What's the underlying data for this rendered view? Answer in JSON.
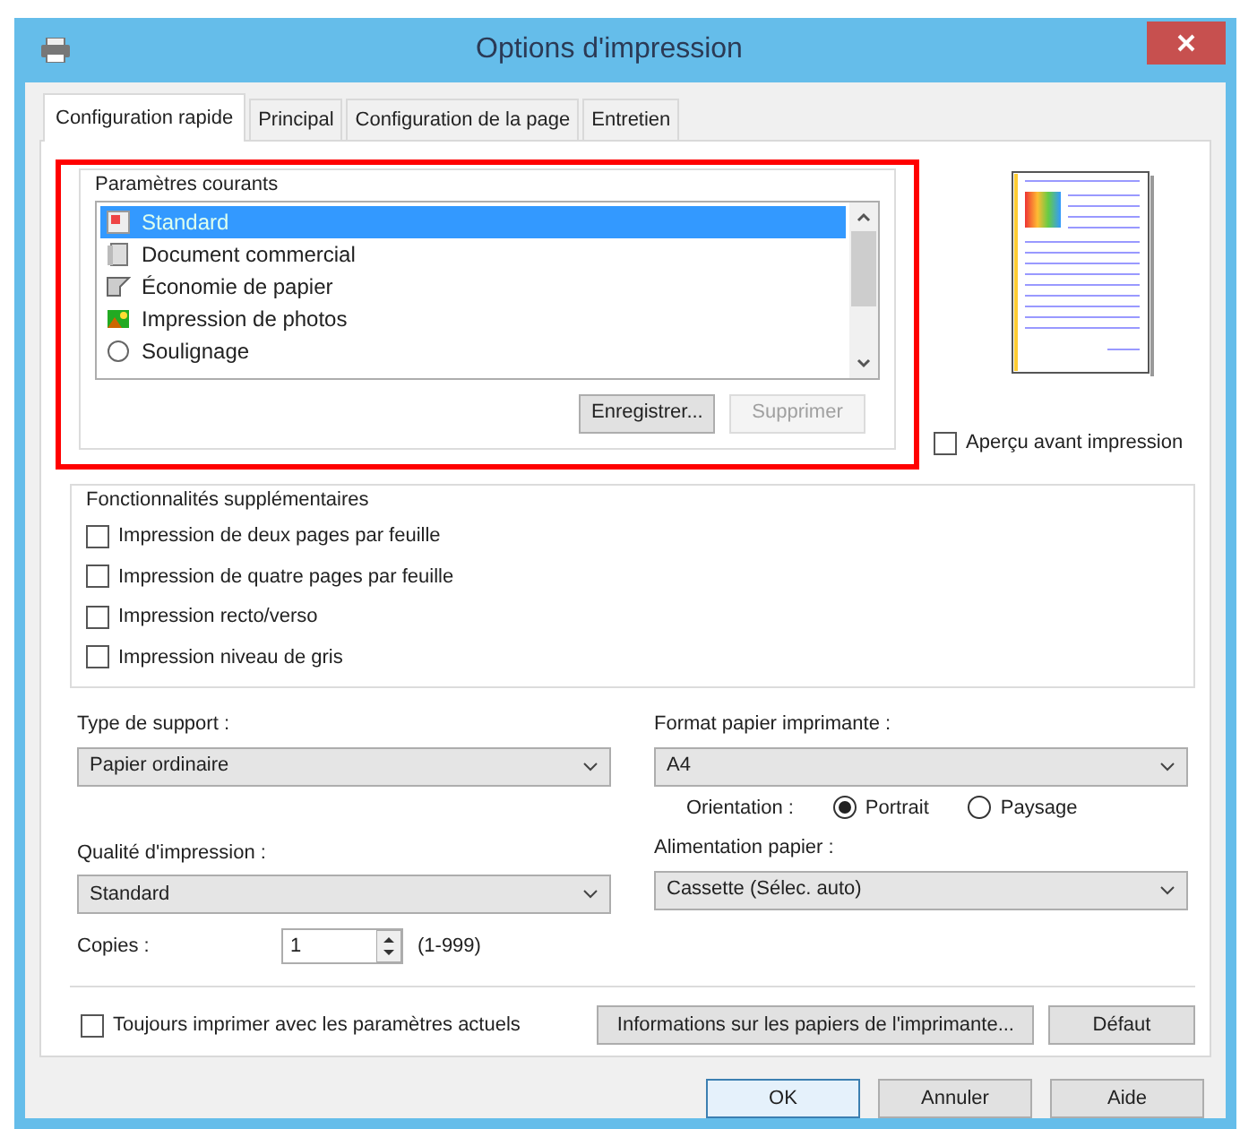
{
  "window": {
    "title": "Options d'impression"
  },
  "tabs": [
    {
      "label": "Configuration rapide",
      "selected": true
    },
    {
      "label": "Principal",
      "selected": false
    },
    {
      "label": "Configuration de la page",
      "selected": false
    },
    {
      "label": "Entretien",
      "selected": false
    }
  ],
  "presets": {
    "legend": "Paramètres courants",
    "items": [
      {
        "label": "Standard",
        "kind": "standard",
        "selected": true
      },
      {
        "label": "Document commercial",
        "kind": "document",
        "selected": false
      },
      {
        "label": "Économie de papier",
        "kind": "paper",
        "selected": false
      },
      {
        "label": "Impression de photos",
        "kind": "photo",
        "selected": false
      },
      {
        "label": "Soulignage",
        "kind": "circle",
        "selected": false
      }
    ],
    "buttons": [
      {
        "label": "Enregistrer...",
        "disabled": false
      },
      {
        "label": "Supprimer",
        "disabled": true
      }
    ]
  },
  "preview": {
    "checkbox": {
      "label": "Aperçu avant impression",
      "checked": false
    }
  },
  "features": {
    "legend": "Fonctionnalités supplémentaires",
    "options": [
      {
        "label": "Impression de deux pages par feuille",
        "checked": false
      },
      {
        "label": "Impression de quatre pages par feuille",
        "checked": false
      },
      {
        "label": "Impression recto/verso",
        "checked": false
      },
      {
        "label": "Impression niveau de gris",
        "checked": false
      }
    ]
  },
  "media_type": {
    "label": "Type de support :",
    "value": "Papier ordinaire"
  },
  "paper_size": {
    "label": "Format papier imprimante :",
    "value": "A4"
  },
  "orientation": {
    "label": "Orientation :",
    "options": [
      {
        "label": "Portrait",
        "selected": true
      },
      {
        "label": "Paysage",
        "selected": false
      }
    ]
  },
  "print_quality": {
    "label": "Qualité d'impression :",
    "value": "Standard"
  },
  "paper_source": {
    "label": "Alimentation papier :",
    "value": "Cassette (Sélec. auto)"
  },
  "copies": {
    "label": "Copies :",
    "value": "1",
    "range": "(1-999)"
  },
  "always_print": {
    "label": "Toujours imprimer avec les paramètres actuels",
    "checked": false
  },
  "info_button": "Informations sur les papiers de l'imprimante...",
  "default_button": "Défaut",
  "dialog_buttons": [
    {
      "label": "OK",
      "default": true
    },
    {
      "label": "Annuler",
      "default": false
    },
    {
      "label": "Aide",
      "default": false
    }
  ]
}
